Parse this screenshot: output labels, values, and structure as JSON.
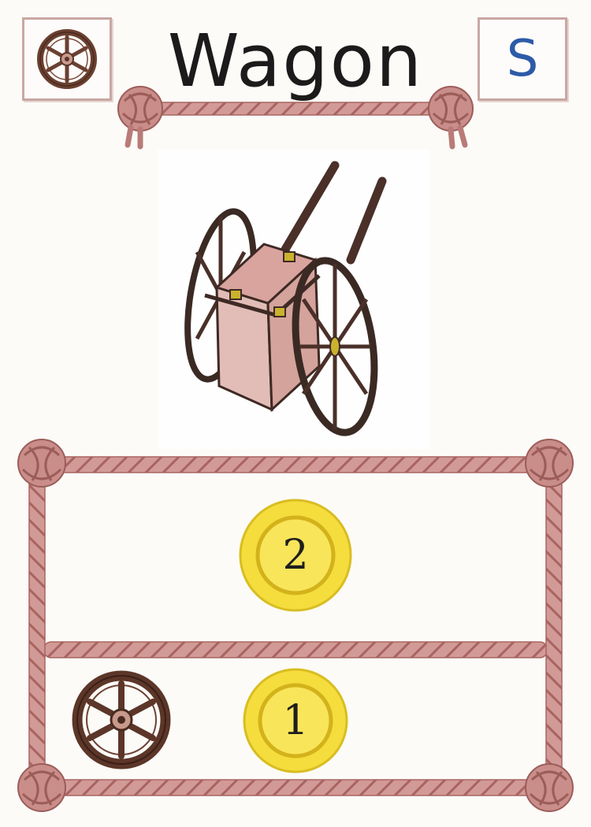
{
  "card": {
    "title": "Wagon",
    "corner_letter": "S",
    "top_left_icon": "wheel-icon",
    "illustration": "wagon-illustration",
    "rows": [
      {
        "icon": null,
        "coin_value": "2"
      },
      {
        "icon": "wheel-icon",
        "coin_value": "1"
      }
    ]
  },
  "colors": {
    "rope": "#c98d8a",
    "wheel": "#6b4030",
    "coin": "#f4dd3c",
    "corner_letter": "#2d5aa8"
  }
}
